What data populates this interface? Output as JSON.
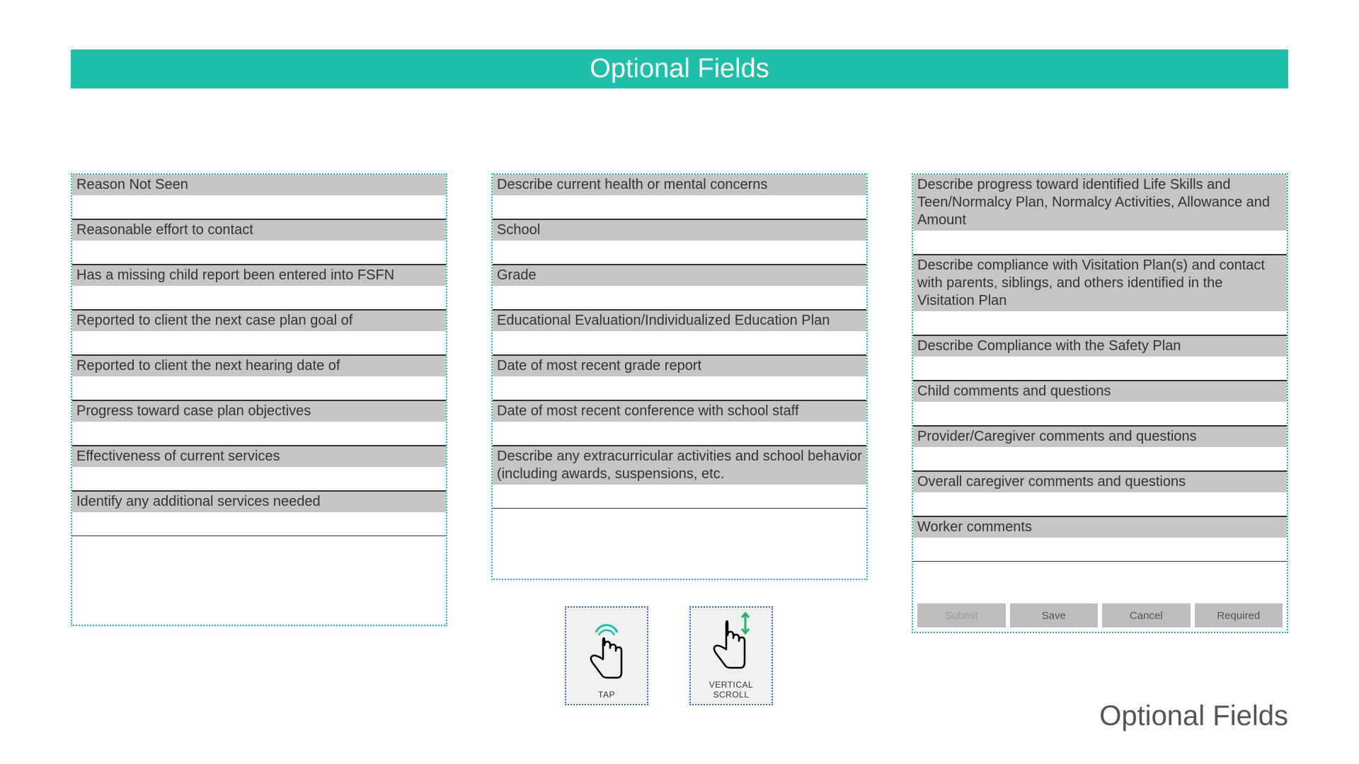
{
  "header": {
    "title": "Optional Fields"
  },
  "columns": {
    "left": [
      {
        "label": "Reason Not Seen"
      },
      {
        "label": "Reasonable effort to contact"
      },
      {
        "label": "Has a missing child report been entered into FSFN"
      },
      {
        "label": "Reported to client the next case plan goal of"
      },
      {
        "label": "Reported to client the next hearing date of"
      },
      {
        "label": "Progress toward case plan objectives"
      },
      {
        "label": "Effectiveness of current services"
      },
      {
        "label": "Identify any additional services needed"
      }
    ],
    "middle": [
      {
        "label": "Describe current health or mental concerns"
      },
      {
        "label": "School"
      },
      {
        "label": "Grade"
      },
      {
        "label": "Educational Evaluation/Individualized Education Plan"
      },
      {
        "label": "Date of most recent grade report"
      },
      {
        "label": "Date of most recent conference with school staff"
      },
      {
        "label": "Describe any extracurricular activities and school behavior (including awards, suspensions, etc."
      }
    ],
    "right": [
      {
        "label": "Describe progress toward identified Life Skills and Teen/Normalcy Plan, Normalcy Activities, Allowance and Amount"
      },
      {
        "label": "Describe compliance with Visitation Plan(s) and contact with parents, siblings, and others identified in the Visitation Plan"
      },
      {
        "label": "Describe Compliance with the Safety Plan"
      },
      {
        "label": "Child comments and questions"
      },
      {
        "label": "Provider/Caregiver comments and questions"
      },
      {
        "label": "Overall caregiver comments and questions"
      },
      {
        "label": "Worker comments"
      }
    ]
  },
  "buttons": {
    "submit": "Submit",
    "save": "Save",
    "cancel": "Cancel",
    "required": "Required"
  },
  "gestures": {
    "tap": "TAP",
    "scroll": "VERTICAL SCROLL"
  },
  "footer": {
    "text": "Optional Fields"
  }
}
